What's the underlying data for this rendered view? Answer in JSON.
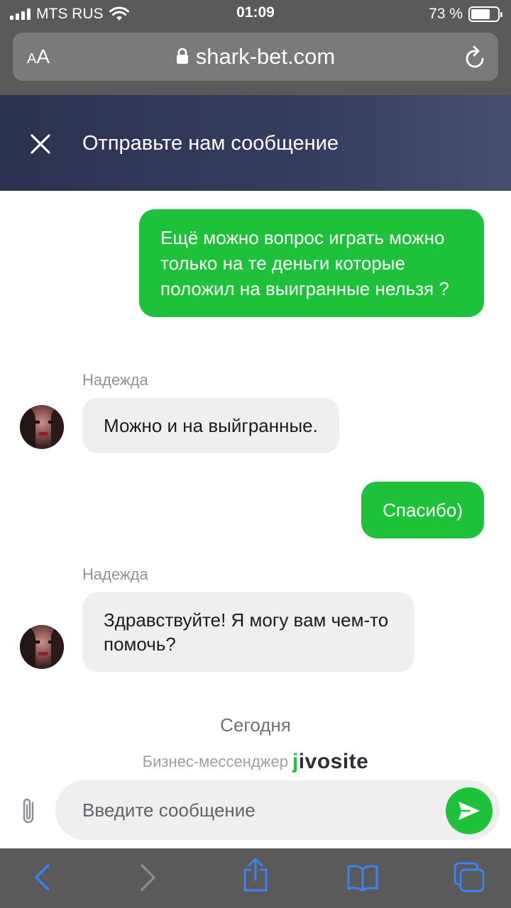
{
  "status_bar": {
    "carrier": "MTS RUS",
    "time": "01:09",
    "battery_percent_label": "73 %",
    "battery_level": 0.73
  },
  "browser": {
    "text_size_label_small": "A",
    "text_size_label_large": "A",
    "url": "shark-bet.com"
  },
  "chat_header": {
    "title": "Отправьте нам сообщение"
  },
  "messages": [
    {
      "direction": "out",
      "text": "Ещё можно вопрос играть можно только на те деньги которые положил на выигранные нельзя ?"
    },
    {
      "direction": "in",
      "sender": "Надежда",
      "text": "Можно и на выйгранные."
    },
    {
      "direction": "out",
      "text": "Спасибо)"
    },
    {
      "direction": "in",
      "sender": "Надежда",
      "text": "Здравствуйте! Я могу вам чем-то помочь?"
    }
  ],
  "date_separator": "Сегодня",
  "powered_by": {
    "text": "Бизнес-мессенджер",
    "brand_j": "j",
    "brand_rest": "ivosite"
  },
  "composer": {
    "placeholder": "Введите сообщение",
    "value": ""
  },
  "colors": {
    "accent_green": "#1dc23a",
    "header_dark": "#2b3250",
    "ios_blue": "#3b82f6"
  },
  "icons": [
    "lock-icon",
    "reload-icon",
    "close-icon",
    "paperclip-icon",
    "send-arrow-icon",
    "back-chevron-icon",
    "forward-chevron-icon",
    "share-icon",
    "bookmarks-icon",
    "tabs-icon",
    "wifi-icon",
    "signal-icon",
    "battery-icon"
  ]
}
